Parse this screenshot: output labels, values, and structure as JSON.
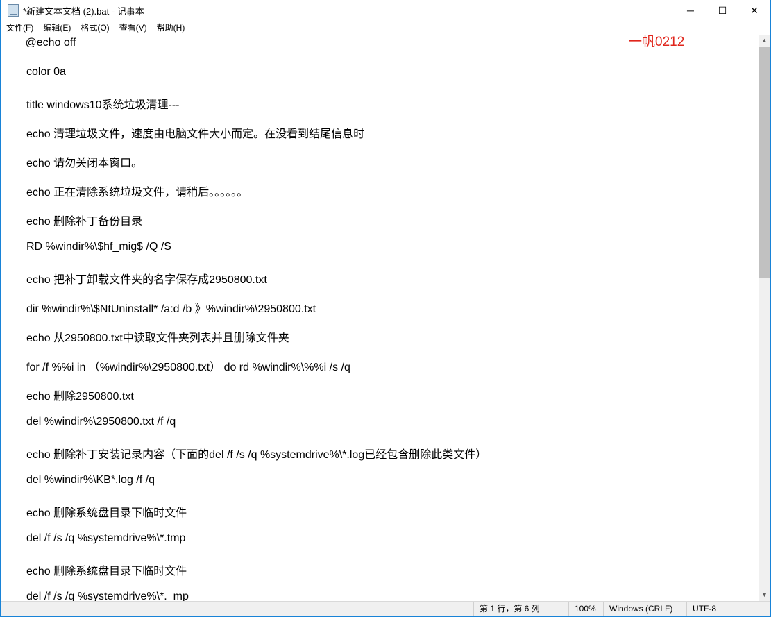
{
  "window": {
    "title": "*新建文本文档 (2).bat - 记事本",
    "minimize": "─",
    "maximize": "☐",
    "close": "✕"
  },
  "menu": [
    "文件(F)",
    "编辑(E)",
    "格式(O)",
    "查看(V)",
    "帮助(H)"
  ],
  "watermark": "一帆0212",
  "lines": [
    " @echo off",
    "color 0a",
    "title windows10系统垃圾清理---",
    "echo 清理垃圾文件，速度由电脑文件大小而定。在没看到结尾信息时",
    "echo 请勿关闭本窗口。",
    "echo 正在清除系统垃圾文件，请稍后。。。。。。",
    "echo 删除补丁备份目录",
    "RD %windir%\\$hf_mig$ /Q /S",
    "echo 把补丁卸载文件夹的名字保存成2950800.txt",
    "dir %windir%\\$NtUninstall* /a:d /b 》%windir%\\2950800.txt",
    "echo 从2950800.txt中读取文件夹列表并且删除文件夹",
    "for /f %%i in （%windir%\\2950800.txt） do rd %windir%\\%%i /s /q",
    "echo 删除2950800.txt",
    "del %windir%\\2950800.txt /f /q",
    "echo 删除补丁安装记录内容（下面的del /f /s /q %systemdrive%\\*.log已经包含删除此类文件）",
    "del %windir%\\KB*.log /f /q",
    "echo 删除系统盘目录下临时文件",
    "del /f /s /q %systemdrive%\\*.tmp",
    "echo 删除系统盘目录下临时文件",
    "del /f /s /q %systemdrive%\\*._mp"
  ],
  "status": {
    "position": "第 1 行，第 6 列",
    "zoom": "100%",
    "line_ending": "Windows (CRLF)",
    "encoding": "UTF-8"
  }
}
